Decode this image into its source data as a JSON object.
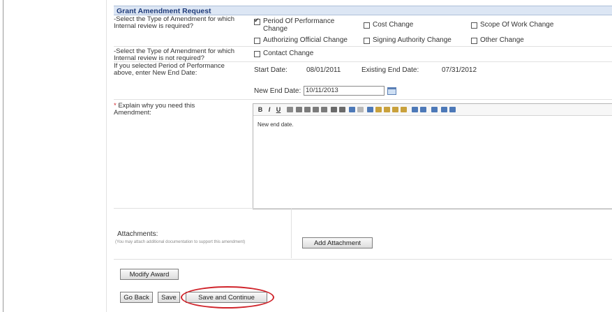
{
  "form": {
    "title": "Grant Amendment Request",
    "q1": {
      "label": "-Select the Type of Amendment for which Internal review is required?",
      "options": [
        {
          "label": "Period Of Performance Change",
          "checked": true
        },
        {
          "label": "Cost Change",
          "checked": false
        },
        {
          "label": "Scope Of Work Change",
          "checked": false
        },
        {
          "label": "Authorizing Official Change",
          "checked": false
        },
        {
          "label": "Signing Authority Change",
          "checked": false
        },
        {
          "label": "Other Change",
          "checked": false
        }
      ]
    },
    "q2": {
      "label": "-Select the Type of Amendment for which Internal review is not required?",
      "options": [
        {
          "label": "Contact Change",
          "checked": false
        }
      ]
    },
    "q3": {
      "label": "If you selected Period of Performance above, enter New End Date:",
      "start_label": "Start Date:",
      "start_value": "08/01/2011",
      "existing_label": "Existing End Date:",
      "existing_value": "07/31/2012",
      "new_end_label": "New End Date:",
      "new_end_value": "10/11/2013"
    },
    "q4": {
      "required_mark": "*",
      "label": "Explain why you need this Amendment:",
      "editor_text": "New end date.",
      "toolbar": [
        "B",
        "I",
        "U"
      ]
    },
    "attachments": {
      "label": "Attachments:",
      "hint": "(You may attach additional documentation to support this amendment)",
      "button": "Add Attachment"
    }
  },
  "buttons": {
    "modify_award": "Modify Award",
    "go_back": "Go Back",
    "save": "Save",
    "save_continue": "Save and Continue"
  },
  "colors": {
    "title_bg": "#dce6f4",
    "title_text": "#1f3b7a",
    "highlight_oval": "#d0242b"
  }
}
